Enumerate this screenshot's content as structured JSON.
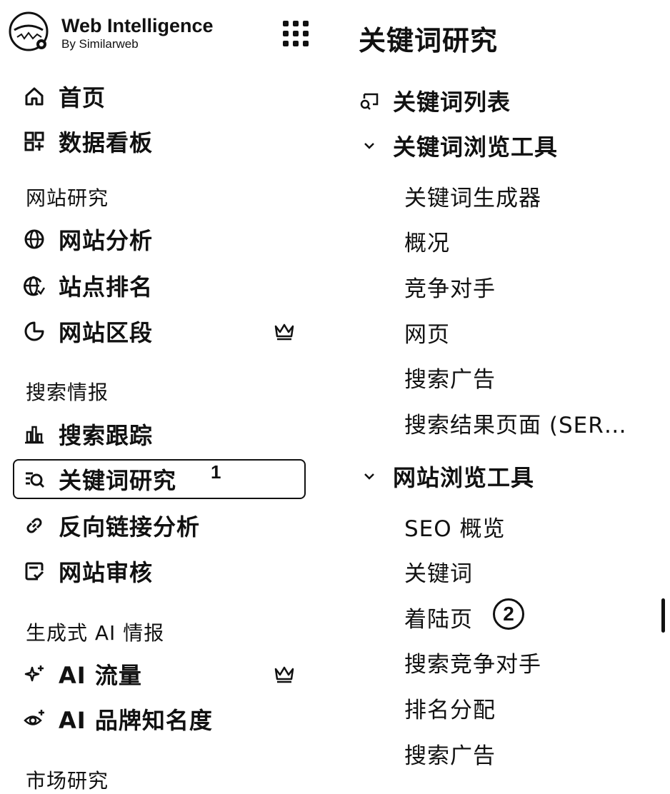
{
  "brand": {
    "title": "Web Intelligence",
    "subtitle": "By Similarweb"
  },
  "left_nav": {
    "top_items": [
      {
        "label": "首页",
        "icon": "home-icon"
      },
      {
        "label": "数据看板",
        "icon": "dashboard-icon"
      }
    ],
    "sections": [
      {
        "title": "网站研究",
        "items": [
          {
            "label": "网站分析",
            "icon": "globe-icon"
          },
          {
            "label": "站点排名",
            "icon": "globe-rank-icon"
          },
          {
            "label": "网站区段",
            "icon": "pie-chart-icon",
            "premium": true
          }
        ]
      },
      {
        "title": "搜索情报",
        "items": [
          {
            "label": "搜索跟踪",
            "icon": "bar-chart-icon"
          },
          {
            "label": "关键词研究",
            "icon": "keyword-search-icon",
            "active": true,
            "annotation": "1"
          },
          {
            "label": "反向链接分析",
            "icon": "link-icon"
          },
          {
            "label": "网站审核",
            "icon": "audit-icon"
          }
        ]
      },
      {
        "title": "生成式 AI 情报",
        "items": [
          {
            "label": "AI 流量",
            "icon": "sparkle-icon",
            "premium": true
          },
          {
            "label": "AI 品牌知名度",
            "icon": "eye-sparkle-icon"
          }
        ]
      },
      {
        "title": "市场研究",
        "items": []
      }
    ]
  },
  "right_panel": {
    "title": "关键词研究",
    "keyword_list": {
      "label": "关键词列表",
      "icon": "list-search-icon"
    },
    "groups": [
      {
        "label": "关键词浏览工具",
        "items": [
          "关键词生成器",
          "概况",
          "竞争对手",
          "网页",
          "搜索广告",
          "搜索结果页面 (SER…"
        ]
      },
      {
        "label": "网站浏览工具",
        "items": [
          "SEO 概览",
          "关键词",
          "着陆页",
          "搜索竞争对手",
          "排名分配",
          "搜索广告"
        ],
        "annotation": "2"
      }
    ]
  }
}
